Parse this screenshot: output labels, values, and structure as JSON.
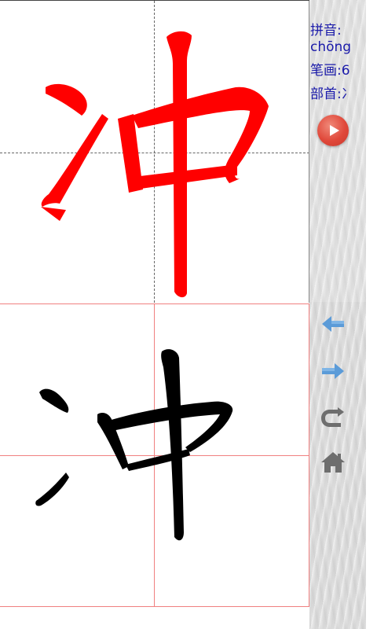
{
  "character": "冲",
  "info": {
    "pinyin_label": "拼音:",
    "pinyin_value": "chōng",
    "strokes_label": "笔画:",
    "strokes_value": "6",
    "radical_label": "部首:",
    "radical_value": "冫"
  },
  "controls": {
    "play": "play-icon",
    "prev": "arrow-left-icon",
    "next": "arrow-right-icon",
    "redo": "redo-icon",
    "home": "home-icon"
  },
  "colors": {
    "stroke_demo": "#ff0000",
    "calligraphy": "#000000",
    "info_text": "#1a1aaa",
    "grid_line": "#f08080",
    "play_button": "#e0483a",
    "nav_arrow": "#5b9bd8",
    "icon_gray": "#6e6e6e"
  }
}
